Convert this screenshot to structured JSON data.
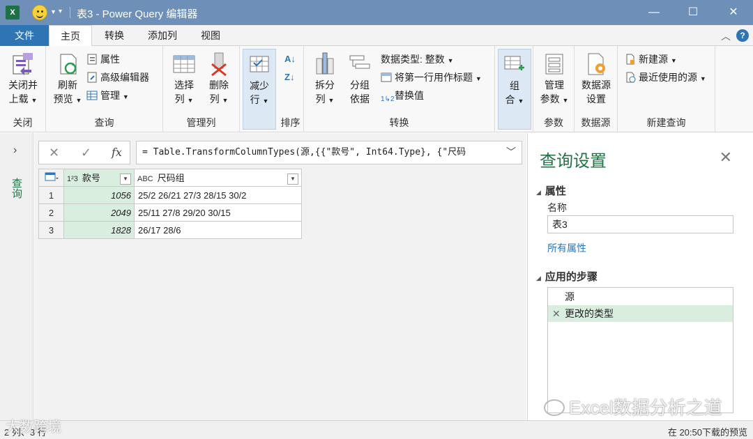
{
  "window": {
    "title": "表3 - Power Query 编辑器",
    "app_icon": "excel-icon",
    "app_letter": "X",
    "buttons": {
      "minimize": "—",
      "maximize": "☐",
      "close": "✕"
    }
  },
  "tabs": [
    {
      "label": "文件"
    },
    {
      "label": "主页"
    },
    {
      "label": "转换"
    },
    {
      "label": "添加列"
    },
    {
      "label": "视图"
    }
  ],
  "ribbon": {
    "close_group": {
      "label": "关闭",
      "close_apply": [
        "关闭并",
        "上载"
      ]
    },
    "query_group": {
      "label": "查询",
      "refresh": [
        "刷新",
        "预览"
      ],
      "properties": "属性",
      "advanced_editor": "高级编辑器",
      "manage": "管理"
    },
    "manage_columns_group": {
      "label": "管理列",
      "choose": [
        "选择",
        "列"
      ],
      "remove": [
        "删除",
        "列"
      ]
    },
    "reduce_rows": [
      "减少",
      "行"
    ],
    "sort_group": {
      "label": "排序"
    },
    "transform_group": {
      "label": "转换",
      "split": [
        "拆分",
        "列"
      ],
      "group_by": [
        "分组",
        "依据"
      ],
      "data_type": "数据类型: 整数",
      "first_row_header": "将第一行用作标题",
      "replace_values": "替换值"
    },
    "combine": [
      "组",
      "合"
    ],
    "params_group": {
      "label": "参数",
      "manage": [
        "管理",
        "参数"
      ]
    },
    "datasource_group": {
      "label": "数据源",
      "settings": [
        "数据源",
        "设置"
      ]
    },
    "new_query_group": {
      "label": "新建查询",
      "new_source": "新建源",
      "recent_sources": "最近使用的源"
    }
  },
  "leftnav": {
    "label": "查询"
  },
  "formula_bar": {
    "cancel": "✕",
    "confirm": "✓",
    "fx": "fx",
    "formula": "= Table.TransformColumnTypes(源,{{\"款号\", Int64.Type}, {\"尺码"
  },
  "grid": {
    "columns": [
      {
        "type_icon": "1²3",
        "name": "款号"
      },
      {
        "type_icon": "ABC",
        "name": "尺码组"
      }
    ],
    "rows": [
      {
        "n": "1",
        "code": "1056",
        "sizes": "25/2 26/21 27/3 28/15 30/2"
      },
      {
        "n": "2",
        "code": "2049",
        "sizes": "25/11 27/8 29/20 30/15"
      },
      {
        "n": "3",
        "code": "1828",
        "sizes": "26/17 28/6"
      }
    ]
  },
  "query_settings": {
    "title": "查询设置",
    "properties_heading": "属性",
    "name_label": "名称",
    "name_value": "表3",
    "all_properties": "所有属性",
    "steps_heading": "应用的步骤",
    "steps": [
      "源",
      "更改的类型"
    ]
  },
  "status": {
    "left": "2 列、3 行",
    "right": "在 20:50下载的预览"
  },
  "watermarks": {
    "wechat": "Excel数据分析之道",
    "brand": "大数跨境"
  },
  "colors": {
    "title_bar": "#6d8fb8",
    "accent_green": "#217346",
    "file_tab": "#2e75b6",
    "selected_fill": "#d9eedf"
  }
}
